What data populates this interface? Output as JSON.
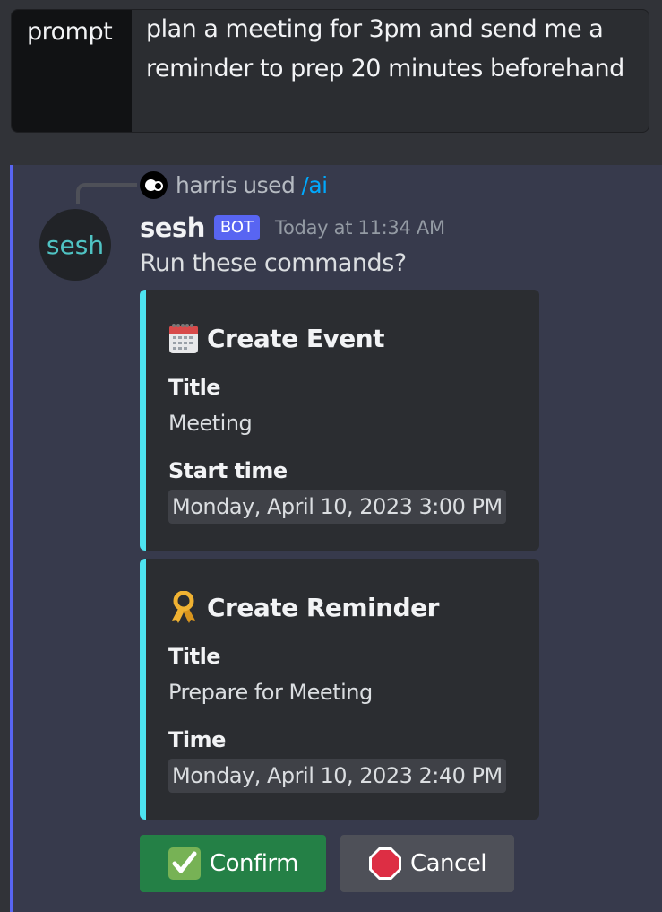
{
  "command_options": {
    "name": "prompt",
    "value": "plan a meeting for 3pm and send me a reminder to prep 20 minutes beforehand"
  },
  "reply": {
    "username": "harris",
    "used_text": "used",
    "command": "/ai"
  },
  "message": {
    "avatar_text": "sesh",
    "username": "sesh",
    "bot_tag": "BOT",
    "timestamp": "Today at 11:34 AM",
    "content": "Run these commands?"
  },
  "embeds": [
    {
      "icon": "calendar-icon",
      "title": "Create Event",
      "fields": [
        {
          "name": "Title",
          "value": "Meeting"
        },
        {
          "name": "Start time",
          "value": "Monday, April 10, 2023 3:00 PM"
        }
      ]
    },
    {
      "icon": "reminder-ribbon-icon",
      "title": "Create Reminder",
      "fields": [
        {
          "name": "Title",
          "value": "Prepare for Meeting"
        },
        {
          "name": "Time",
          "value": "Monday, April 10, 2023 2:40 PM"
        }
      ]
    }
  ],
  "buttons": {
    "confirm": {
      "label": "Confirm",
      "icon": "check-mark-icon"
    },
    "cancel": {
      "label": "Cancel",
      "icon": "stop-sign-icon"
    }
  },
  "colors": {
    "background": "#313338",
    "highlight": "#373a4c",
    "mention_bar": "#5865f2",
    "embed_accent": "#4de3f0",
    "confirm": "#248046",
    "cancel": "#4e5058"
  }
}
